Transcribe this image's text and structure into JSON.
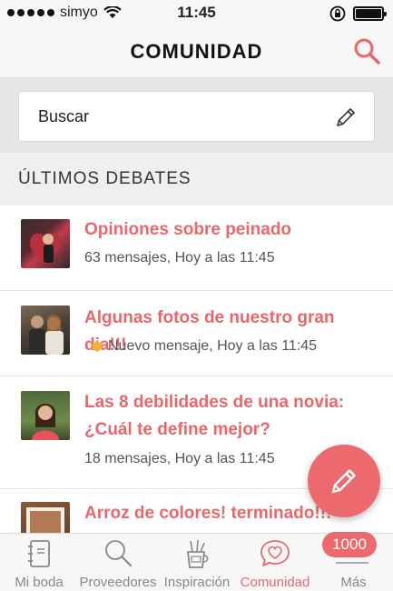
{
  "status_bar": {
    "carrier": "simyo",
    "time": "11:45"
  },
  "header": {
    "title": "COMUNIDAD",
    "search_icon": "search-icon"
  },
  "search": {
    "placeholder": "Buscar",
    "edit_icon": "pencil-icon"
  },
  "section": {
    "title": "ÚLTIMOS DEBATES"
  },
  "debates": [
    {
      "title": "Opiniones sobre peinado",
      "meta": "63 mensajes, Hoy a las 11:45"
    },
    {
      "title": "Algunas fotos de nuestro gran dia!!!",
      "meta": "Nuevo mensaje, Hoy a las 11:45",
      "new_indicator": true
    },
    {
      "title": "Las 8 debilidades de una novia: ¿Cuál te define mejor?",
      "meta": "18 mensajes, Hoy a las 11:45"
    },
    {
      "title": "Arroz de colores! terminado!!!",
      "meta": ""
    }
  ],
  "fab": {
    "icon": "pencil-icon"
  },
  "tabbar": {
    "tabs": [
      {
        "label": "Mi boda",
        "icon": "notebook-icon"
      },
      {
        "label": "Proveedores",
        "icon": "magnifier-icon"
      },
      {
        "label": "Inspiración",
        "icon": "cup-brushes-icon"
      },
      {
        "label": "Comunidad",
        "icon": "heart-bubble-icon",
        "active": true
      },
      {
        "label": "Más",
        "icon": "more-icon"
      }
    ],
    "badge": "1000"
  },
  "colors": {
    "accent": "#e9676b",
    "fab": "#ec6a6e",
    "new_dot": "#f2b233"
  }
}
